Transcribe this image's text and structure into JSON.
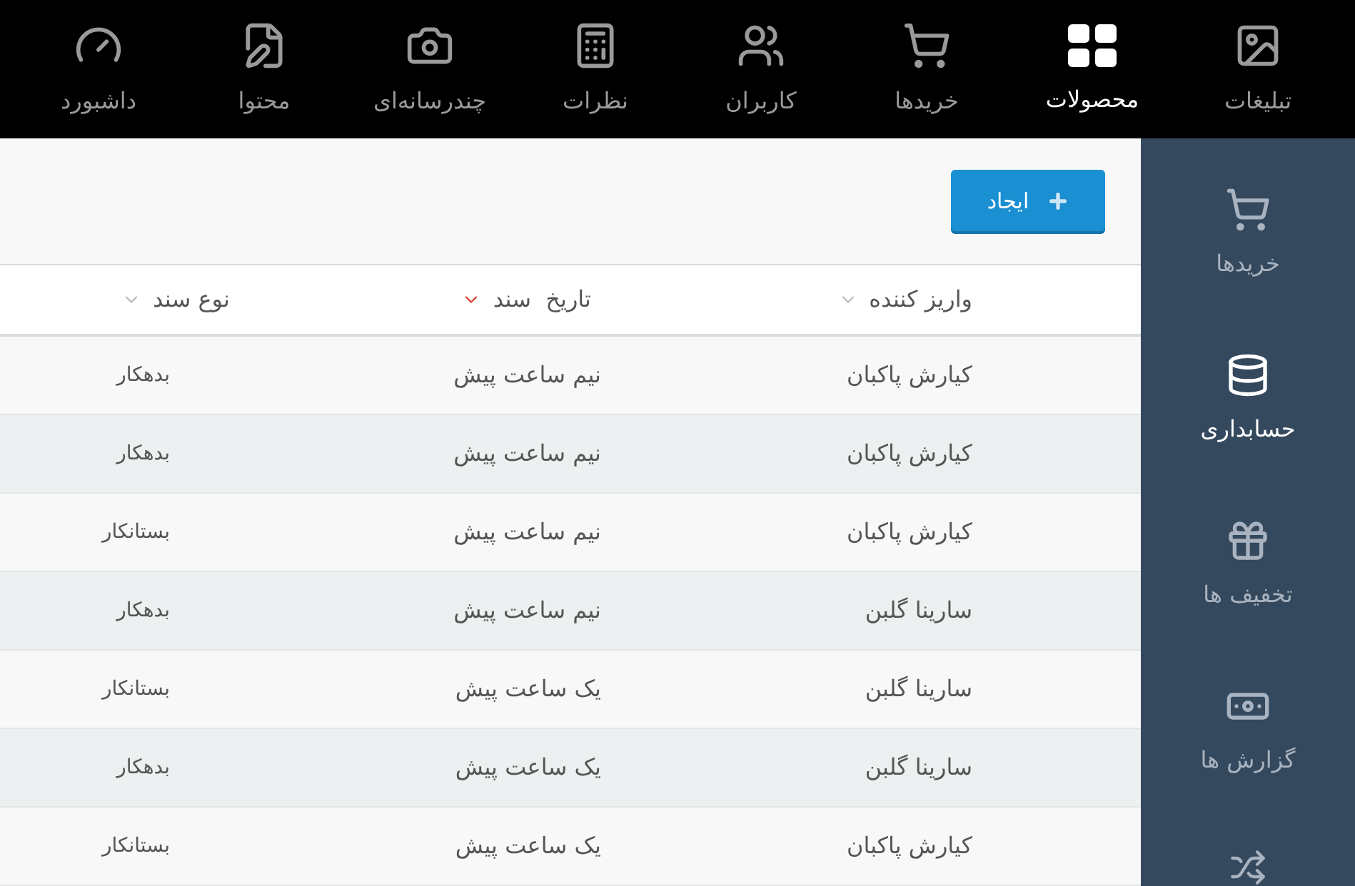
{
  "top_nav": [
    {
      "label": "تبلیغات",
      "selected": false
    },
    {
      "label": "محصولات",
      "selected": true
    },
    {
      "label": "خریدها",
      "selected": false
    },
    {
      "label": "کاربران",
      "selected": false
    },
    {
      "label": "نظرات",
      "selected": false
    },
    {
      "label": "چندرسانه‌ای",
      "selected": false
    },
    {
      "label": "محتوا",
      "selected": false
    },
    {
      "label": "داشبورد",
      "selected": false
    }
  ],
  "sidebar": {
    "items": [
      {
        "label": "خریدها",
        "selected": false
      },
      {
        "label": "حسابداری",
        "selected": true
      },
      {
        "label": "تخفیف ها",
        "selected": false
      },
      {
        "label": "گزارش ها",
        "selected": false
      }
    ]
  },
  "toolbar": {
    "create_button": "ایجاد"
  },
  "table": {
    "columns": [
      {
        "label": "واریز کننده",
        "sorted": false
      },
      {
        "label": "تاریخ  سند",
        "sorted": true
      },
      {
        "label": "نوع سند",
        "sorted": false
      }
    ],
    "rows": [
      [
        "کیارش پاکبان",
        "نیم ساعت پیش",
        "بدهکار"
      ],
      [
        "کیارش پاکبان",
        "نیم ساعت پیش",
        "بدهکار"
      ],
      [
        "کیارش پاکبان",
        "نیم ساعت پیش",
        "بستانکار"
      ],
      [
        "سارینا گلبن",
        "نیم ساعت پیش",
        "بدهکار"
      ],
      [
        "سارینا گلبن",
        "یک ساعت پیش",
        "بستانکار"
      ],
      [
        "سارینا گلبن",
        "یک ساعت پیش",
        "بدهکار"
      ],
      [
        "کیارش پاکبان",
        "یک ساعت پیش",
        "بستانکار"
      ]
    ]
  }
}
